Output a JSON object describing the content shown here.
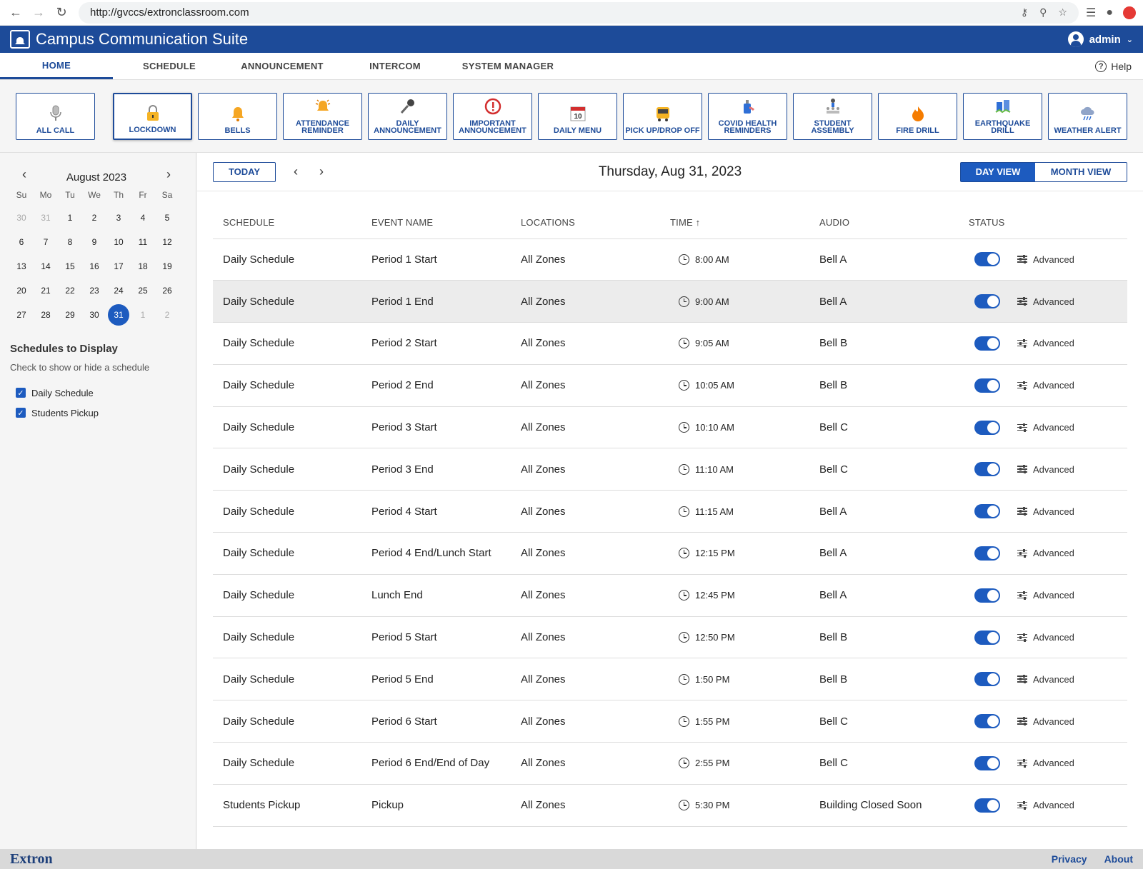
{
  "browser": {
    "url": "http://gvccs/extronclassroom.com"
  },
  "app": {
    "title": "Campus Communication Suite",
    "user": "admin"
  },
  "tabs": [
    {
      "label": "HOME"
    },
    {
      "label": "SCHEDULE"
    },
    {
      "label": "ANNOUNCEMENT"
    },
    {
      "label": "INTERCOM"
    },
    {
      "label": "SYSTEM MANAGER"
    }
  ],
  "help_label": "Help",
  "quick_buttons": [
    {
      "label": "ALL CALL",
      "icon": "microphone-icon"
    },
    {
      "label": "LOCKDOWN",
      "icon": "lock-icon"
    },
    {
      "label": "BELLS",
      "icon": "bell-icon"
    },
    {
      "label": "ATTENDANCE REMINDER",
      "icon": "ringing-bell-icon"
    },
    {
      "label": "DAILY ANNOUNCEMENT",
      "icon": "handheld-mic-icon"
    },
    {
      "label": "IMPORTANT ANNOUNCEMENT",
      "icon": "alert-icon"
    },
    {
      "label": "DAILY MENU",
      "icon": "calendar-icon"
    },
    {
      "label": "PICK UP/DROP OFF",
      "icon": "bus-icon"
    },
    {
      "label": "COVID HEALTH REMINDERS",
      "icon": "sanitizer-icon"
    },
    {
      "label": "STUDENT ASSEMBLY",
      "icon": "people-icon"
    },
    {
      "label": "FIRE DRILL",
      "icon": "fire-icon"
    },
    {
      "label": "EARTHQUAKE DRILL",
      "icon": "earthquake-icon"
    },
    {
      "label": "WEATHER ALERT",
      "icon": "storm-icon"
    }
  ],
  "calendar": {
    "month_label": "August 2023",
    "weekdays": [
      "Su",
      "Mo",
      "Tu",
      "We",
      "Th",
      "Fr",
      "Sa"
    ],
    "days": [
      "30",
      "31",
      "1",
      "2",
      "3",
      "4",
      "5",
      "6",
      "7",
      "8",
      "9",
      "10",
      "11",
      "12",
      "13",
      "14",
      "15",
      "16",
      "17",
      "18",
      "19",
      "20",
      "21",
      "22",
      "23",
      "24",
      "25",
      "26",
      "27",
      "28",
      "29",
      "30",
      "31",
      "1",
      "2"
    ]
  },
  "schedules_panel": {
    "title": "Schedules to Display",
    "subtitle": "Check to show or hide a schedule",
    "items": [
      {
        "label": "Daily Schedule",
        "checked": true
      },
      {
        "label": "Students Pickup",
        "checked": true
      }
    ]
  },
  "toolbar": {
    "today_label": "TODAY",
    "date_title": "Thursday, Aug 31, 2023",
    "day_view_label": "DAY VIEW",
    "month_view_label": "MONTH VIEW"
  },
  "table": {
    "headers": [
      "SCHEDULE",
      "EVENT NAME",
      "LOCATIONS",
      "TIME",
      "AUDIO",
      "STATUS"
    ],
    "advanced_label": "Advanced",
    "rows": [
      {
        "schedule": "Daily Schedule",
        "event": "Period 1 Start",
        "location": "All Zones",
        "time": "8:00 AM",
        "audio": "Bell A"
      },
      {
        "schedule": "Daily Schedule",
        "event": "Period 1 End",
        "location": "All Zones",
        "time": "9:00 AM",
        "audio": "Bell A"
      },
      {
        "schedule": "Daily Schedule",
        "event": "Period 2 Start",
        "location": "All Zones",
        "time": "9:05 AM",
        "audio": "Bell B"
      },
      {
        "schedule": "Daily Schedule",
        "event": "Period 2 End",
        "location": "All Zones",
        "time": "10:05 AM",
        "audio": "Bell B"
      },
      {
        "schedule": "Daily Schedule",
        "event": "Period 3 Start",
        "location": "All Zones",
        "time": "10:10 AM",
        "audio": "Bell C"
      },
      {
        "schedule": "Daily Schedule",
        "event": "Period 3 End",
        "location": "All Zones",
        "time": "11:10 AM",
        "audio": "Bell C"
      },
      {
        "schedule": "Daily Schedule",
        "event": "Period 4 Start",
        "location": "All Zones",
        "time": "11:15 AM",
        "audio": "Bell A"
      },
      {
        "schedule": "Daily Schedule",
        "event": "Period 4 End/Lunch Start",
        "location": "All Zones",
        "time": "12:15 PM",
        "audio": "Bell A"
      },
      {
        "schedule": "Daily Schedule",
        "event": "Lunch End",
        "location": "All Zones",
        "time": "12:45 PM",
        "audio": "Bell A"
      },
      {
        "schedule": "Daily Schedule",
        "event": "Period 5 Start",
        "location": "All Zones",
        "time": "12:50 PM",
        "audio": "Bell B"
      },
      {
        "schedule": "Daily Schedule",
        "event": "Period 5 End",
        "location": "All Zones",
        "time": "1:50 PM",
        "audio": "Bell B"
      },
      {
        "schedule": "Daily Schedule",
        "event": "Period 6 Start",
        "location": "All Zones",
        "time": "1:55 PM",
        "audio": "Bell C"
      },
      {
        "schedule": "Daily Schedule",
        "event": "Period 6 End/End of Day",
        "location": "All Zones",
        "time": "2:55 PM",
        "audio": "Bell C"
      },
      {
        "schedule": "Students Pickup",
        "event": "Pickup",
        "location": "All Zones",
        "time": "5:30 PM",
        "audio": "Building Closed Soon"
      }
    ]
  },
  "footer": {
    "logo": "Extron",
    "privacy_label": "Privacy",
    "about_label": "About"
  },
  "colors": {
    "brand": "#1d4b99",
    "accent": "#1d5bbf"
  }
}
